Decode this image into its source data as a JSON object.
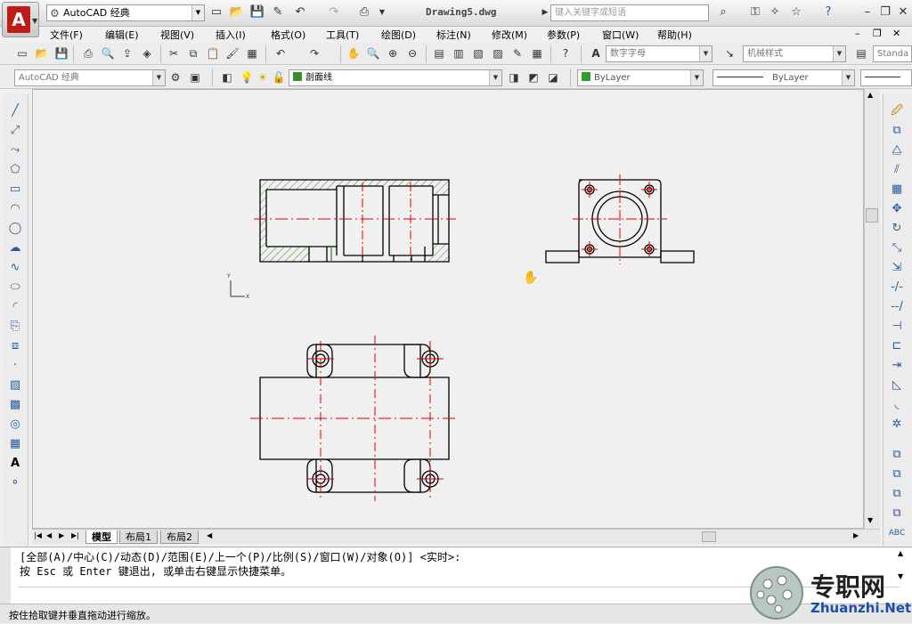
{
  "app": {
    "workspace": "AutoCAD 经典",
    "doc_title": "Drawing5.dwg",
    "search_placeholder": "键入关键字或短语"
  },
  "menu": [
    "文件(F)",
    "编辑(E)",
    "视图(V)",
    "插入(I)",
    "格式(O)",
    "工具(T)",
    "绘图(D)",
    "标注(N)",
    "修改(M)",
    "参数(P)",
    "窗口(W)",
    "帮助(H)"
  ],
  "toolbar": {
    "text_style": "数字字母",
    "dim_style": "机械样式",
    "table_style": "Standa",
    "workspace2": "AutoCAD 经典",
    "layer": "剖面线",
    "color": "ByLayer",
    "linetype": "ByLayer"
  },
  "tabs": [
    "模型",
    "布局1",
    "布局2"
  ],
  "command": {
    "line1": "[全部(A)/中心(C)/动态(D)/范围(E)/上一个(P)/比例(S)/窗口(W)/对象(O)] <实时>:",
    "line2": "按 Esc 或 Enter 键退出, 或单击右键显示快捷菜单。"
  },
  "status": "按住拾取键并垂直拖动进行缩放。",
  "watermark": {
    "cn": "专职网",
    "en": "Zhuanzhi.Net"
  },
  "colors": {
    "accent": "#c11b17",
    "centerline": "#e00000",
    "hatch": "#3a8f2a",
    "status_green": "#2e9e2e"
  }
}
